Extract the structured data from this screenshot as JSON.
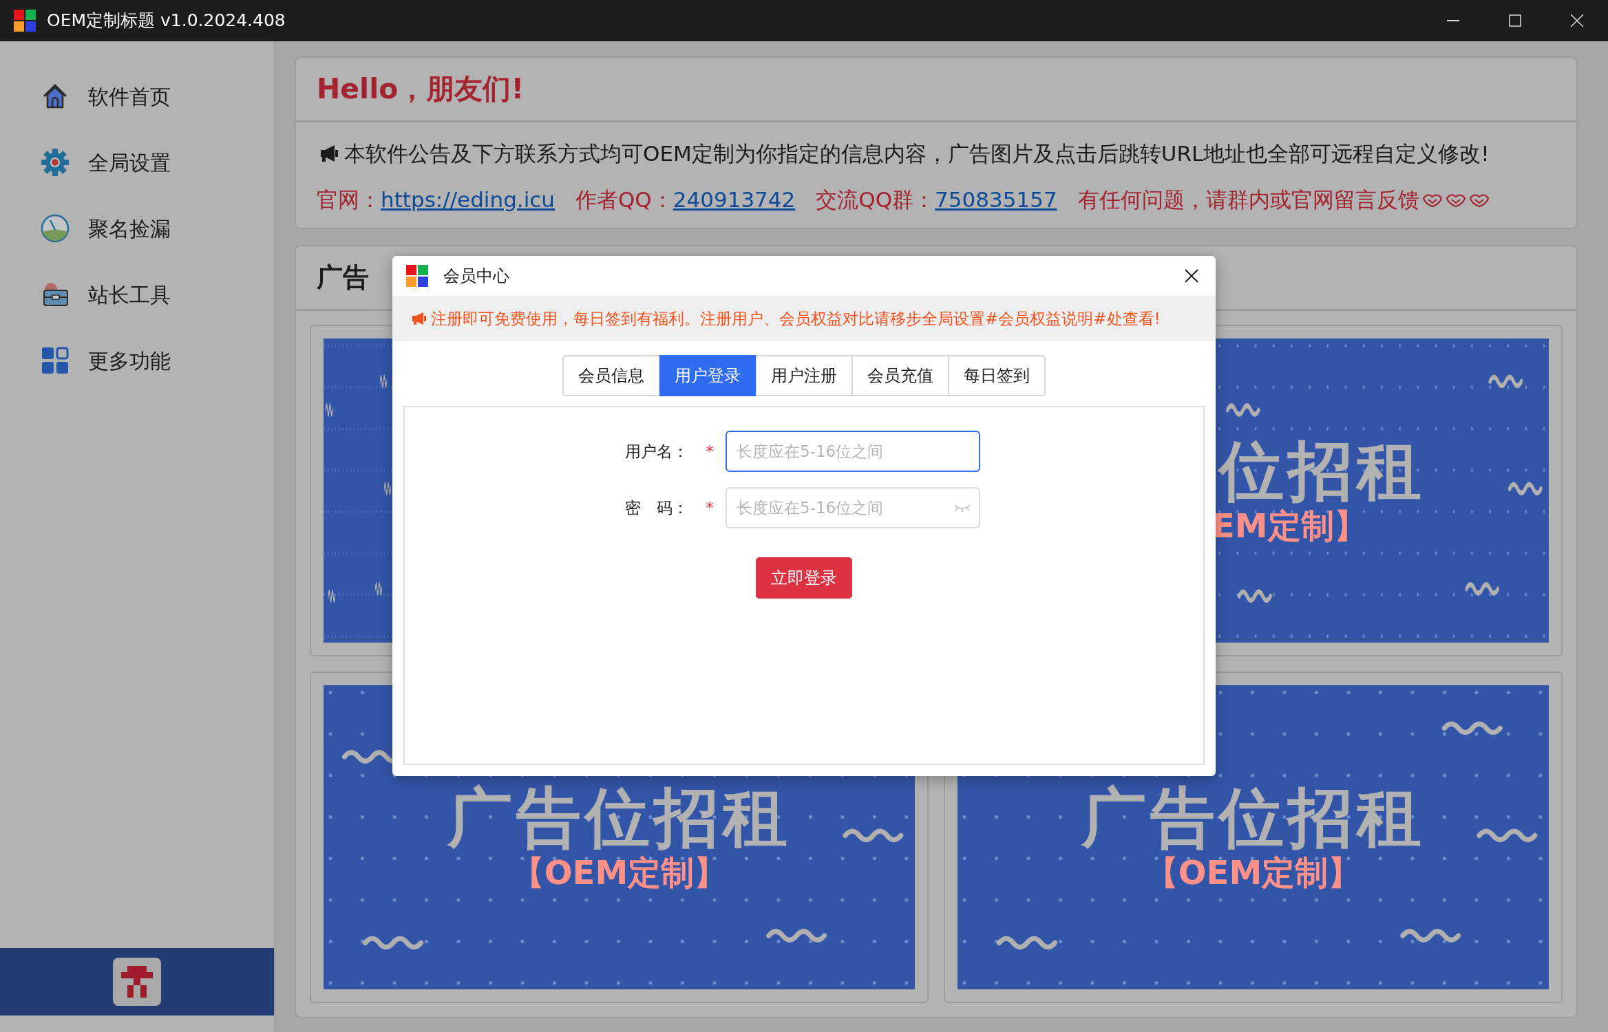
{
  "window": {
    "title": "OEM定制标题 v1.0.2024.408"
  },
  "sidebar": {
    "items": [
      {
        "label": "软件首页",
        "kind": "home"
      },
      {
        "label": "全局设置",
        "kind": "gear"
      },
      {
        "label": "聚名捡漏",
        "kind": "gauge"
      },
      {
        "label": "站长工具",
        "kind": "toolbox"
      },
      {
        "label": "更多功能",
        "kind": "grid"
      }
    ]
  },
  "notice": {
    "title": "Hello，朋友们!",
    "announcement": "本软件公告及下方联系方式均可OEM定制为你指定的信息内容，广告图片及点击后跳转URL地址也全部可远程自定义修改!",
    "contacts": [
      {
        "label": "官网：",
        "link": "https://eding.icu"
      },
      {
        "label": "作者QQ：",
        "link": "240913742"
      },
      {
        "label": "交流QQ群：",
        "link": "750835157"
      }
    ],
    "footer": "有任何问题，请群内或官网留言反馈"
  },
  "ads": {
    "title": "广告",
    "banners": [
      {
        "kind": "hidden"
      },
      {
        "kind": "cut",
        "headline": "位招租",
        "tag": "EM定制】"
      },
      {
        "kind": "full",
        "headline": "广告位招租",
        "tag": "【OEM定制】"
      },
      {
        "kind": "full",
        "headline": "广告位招租",
        "tag": "【OEM定制】"
      }
    ]
  },
  "dialog": {
    "title": "会员中心",
    "notice": "注册即可免费使用，每日签到有福利。注册用户、会员权益对比请移步全局设置#会员权益说明#处查看!",
    "tabs": [
      {
        "label": "会员信息",
        "selected": false
      },
      {
        "label": "用户登录",
        "selected": true
      },
      {
        "label": "用户注册",
        "selected": false
      },
      {
        "label": "会员充值",
        "selected": false
      },
      {
        "label": "每日签到",
        "selected": false
      }
    ],
    "fields": [
      {
        "kind": "text",
        "label": "用户名：",
        "required_mark": "*",
        "placeholder": "长度应在5-16位之间",
        "focused": true
      },
      {
        "kind": "password",
        "label": "密　码：",
        "required_mark": "*",
        "placeholder": "长度应在5-16位之间",
        "focused": false
      }
    ],
    "submit": "立即登录"
  }
}
